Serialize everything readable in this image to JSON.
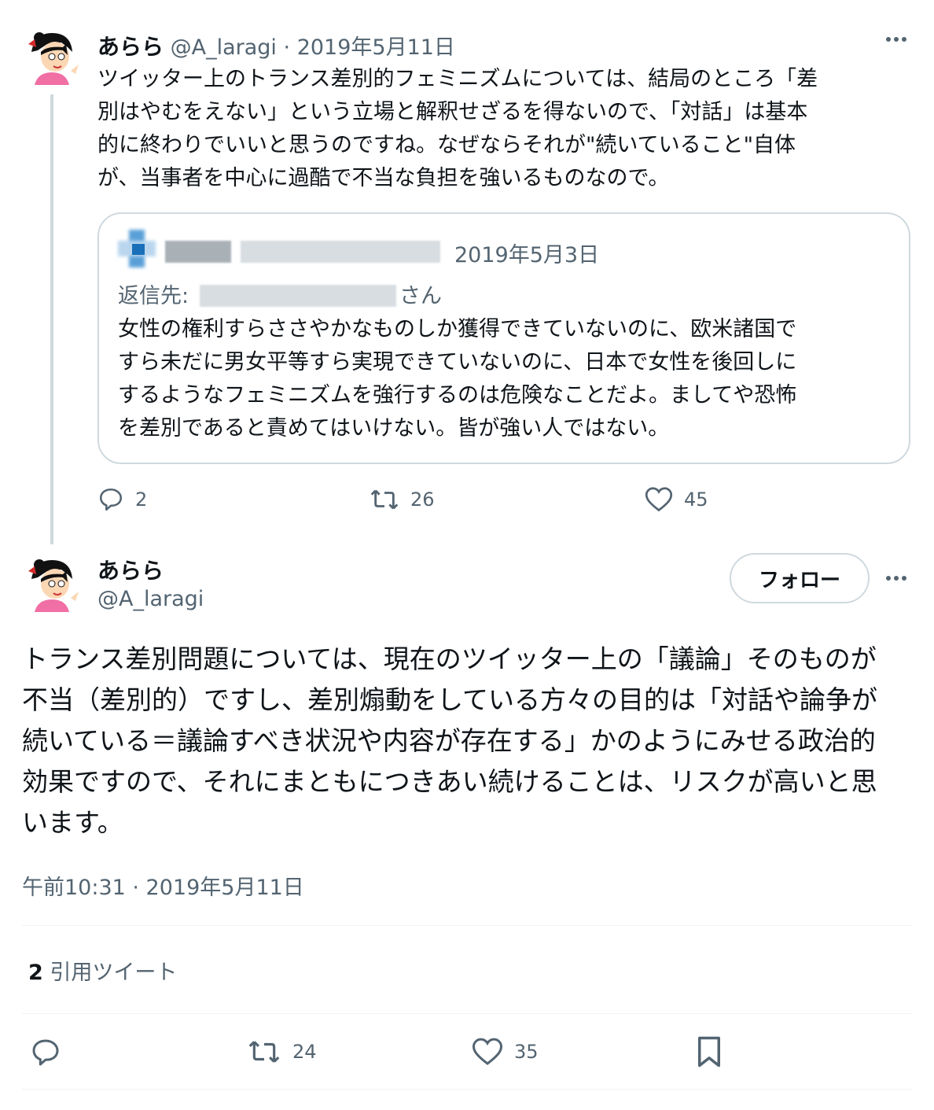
{
  "post1": {
    "display_name": "あらら",
    "handle": "@A_laragi",
    "date": "2019年5月11日",
    "text": "ツイッター上のトランス差別的フェミニズムについては、結局のところ「差\n別はやむをえない」という立場と解釈せざるを得ないので、「対話」は基本\n的に終わりでいいと思うのですね。なぜならそれが\"続いていること\"自体\nが、当事者を中心に過酷で不当な負担を強いるものなので。",
    "quote": {
      "date": "2019年5月3日",
      "reply_prefix": "返信先:",
      "reply_suffix": "さん",
      "text": "女性の権利すらささやかなものしか獲得できていないのに、欧米諸国で\nすら未だに男女平等すら実現できていないのに、日本で女性を後回しに\nするようなフェミニズムを強行するのは危険なことだよ。ましてや恐怖\nを差別であると責めてはいけない。皆が強い人ではない。"
    },
    "replies": "2",
    "retweets": "26",
    "likes": "45"
  },
  "post2": {
    "display_name": "あらら",
    "handle": "@A_laragi",
    "follow_label": "フォロー",
    "text": "トランス差別問題については、現在のツイッター上の「議論」そのものが\n不当（差別的）ですし、差別煽動をしている方々の目的は「対話や論争が\n続いている＝議論すべき状況や内容が存在する」かのようにみせる政治的\n効果ですので、それにまともにつきあい続けることは、リスクが高いと思\nいます。",
    "timestamp": "午前10:31 · 2019年5月11日",
    "quote_count": "2",
    "quote_label": "引用ツイート",
    "retweets": "24",
    "likes": "35"
  },
  "icons": {
    "more": "more-icon",
    "reply": "reply-icon",
    "retweet": "retweet-icon",
    "like": "heart-icon",
    "bookmark": "bookmark-icon"
  }
}
